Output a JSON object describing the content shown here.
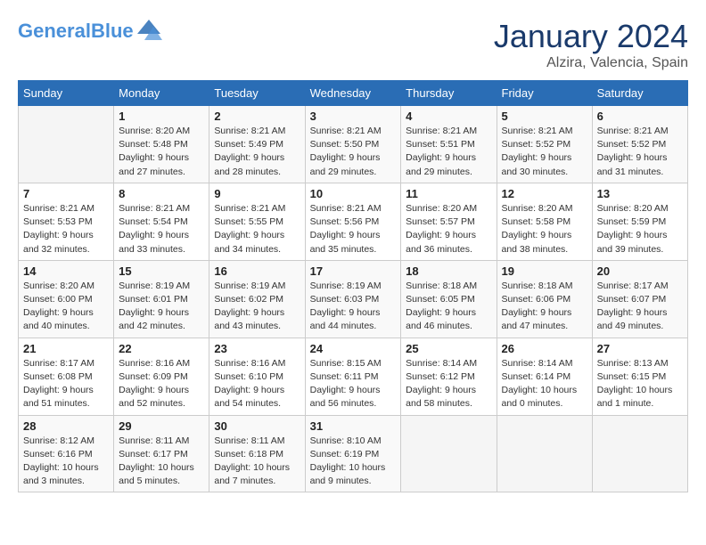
{
  "header": {
    "logo_text_general": "General",
    "logo_text_blue": "Blue",
    "month_title": "January 2024",
    "subtitle": "Alzira, Valencia, Spain"
  },
  "calendar": {
    "days_of_week": [
      "Sunday",
      "Monday",
      "Tuesday",
      "Wednesday",
      "Thursday",
      "Friday",
      "Saturday"
    ],
    "weeks": [
      [
        {
          "day": "",
          "info": ""
        },
        {
          "day": "1",
          "info": "Sunrise: 8:20 AM\nSunset: 5:48 PM\nDaylight: 9 hours\nand 27 minutes."
        },
        {
          "day": "2",
          "info": "Sunrise: 8:21 AM\nSunset: 5:49 PM\nDaylight: 9 hours\nand 28 minutes."
        },
        {
          "day": "3",
          "info": "Sunrise: 8:21 AM\nSunset: 5:50 PM\nDaylight: 9 hours\nand 29 minutes."
        },
        {
          "day": "4",
          "info": "Sunrise: 8:21 AM\nSunset: 5:51 PM\nDaylight: 9 hours\nand 29 minutes."
        },
        {
          "day": "5",
          "info": "Sunrise: 8:21 AM\nSunset: 5:52 PM\nDaylight: 9 hours\nand 30 minutes."
        },
        {
          "day": "6",
          "info": "Sunrise: 8:21 AM\nSunset: 5:52 PM\nDaylight: 9 hours\nand 31 minutes."
        }
      ],
      [
        {
          "day": "7",
          "info": "Sunrise: 8:21 AM\nSunset: 5:53 PM\nDaylight: 9 hours\nand 32 minutes."
        },
        {
          "day": "8",
          "info": "Sunrise: 8:21 AM\nSunset: 5:54 PM\nDaylight: 9 hours\nand 33 minutes."
        },
        {
          "day": "9",
          "info": "Sunrise: 8:21 AM\nSunset: 5:55 PM\nDaylight: 9 hours\nand 34 minutes."
        },
        {
          "day": "10",
          "info": "Sunrise: 8:21 AM\nSunset: 5:56 PM\nDaylight: 9 hours\nand 35 minutes."
        },
        {
          "day": "11",
          "info": "Sunrise: 8:20 AM\nSunset: 5:57 PM\nDaylight: 9 hours\nand 36 minutes."
        },
        {
          "day": "12",
          "info": "Sunrise: 8:20 AM\nSunset: 5:58 PM\nDaylight: 9 hours\nand 38 minutes."
        },
        {
          "day": "13",
          "info": "Sunrise: 8:20 AM\nSunset: 5:59 PM\nDaylight: 9 hours\nand 39 minutes."
        }
      ],
      [
        {
          "day": "14",
          "info": "Sunrise: 8:20 AM\nSunset: 6:00 PM\nDaylight: 9 hours\nand 40 minutes."
        },
        {
          "day": "15",
          "info": "Sunrise: 8:19 AM\nSunset: 6:01 PM\nDaylight: 9 hours\nand 42 minutes."
        },
        {
          "day": "16",
          "info": "Sunrise: 8:19 AM\nSunset: 6:02 PM\nDaylight: 9 hours\nand 43 minutes."
        },
        {
          "day": "17",
          "info": "Sunrise: 8:19 AM\nSunset: 6:03 PM\nDaylight: 9 hours\nand 44 minutes."
        },
        {
          "day": "18",
          "info": "Sunrise: 8:18 AM\nSunset: 6:05 PM\nDaylight: 9 hours\nand 46 minutes."
        },
        {
          "day": "19",
          "info": "Sunrise: 8:18 AM\nSunset: 6:06 PM\nDaylight: 9 hours\nand 47 minutes."
        },
        {
          "day": "20",
          "info": "Sunrise: 8:17 AM\nSunset: 6:07 PM\nDaylight: 9 hours\nand 49 minutes."
        }
      ],
      [
        {
          "day": "21",
          "info": "Sunrise: 8:17 AM\nSunset: 6:08 PM\nDaylight: 9 hours\nand 51 minutes."
        },
        {
          "day": "22",
          "info": "Sunrise: 8:16 AM\nSunset: 6:09 PM\nDaylight: 9 hours\nand 52 minutes."
        },
        {
          "day": "23",
          "info": "Sunrise: 8:16 AM\nSunset: 6:10 PM\nDaylight: 9 hours\nand 54 minutes."
        },
        {
          "day": "24",
          "info": "Sunrise: 8:15 AM\nSunset: 6:11 PM\nDaylight: 9 hours\nand 56 minutes."
        },
        {
          "day": "25",
          "info": "Sunrise: 8:14 AM\nSunset: 6:12 PM\nDaylight: 9 hours\nand 58 minutes."
        },
        {
          "day": "26",
          "info": "Sunrise: 8:14 AM\nSunset: 6:14 PM\nDaylight: 10 hours\nand 0 minutes."
        },
        {
          "day": "27",
          "info": "Sunrise: 8:13 AM\nSunset: 6:15 PM\nDaylight: 10 hours\nand 1 minute."
        }
      ],
      [
        {
          "day": "28",
          "info": "Sunrise: 8:12 AM\nSunset: 6:16 PM\nDaylight: 10 hours\nand 3 minutes."
        },
        {
          "day": "29",
          "info": "Sunrise: 8:11 AM\nSunset: 6:17 PM\nDaylight: 10 hours\nand 5 minutes."
        },
        {
          "day": "30",
          "info": "Sunrise: 8:11 AM\nSunset: 6:18 PM\nDaylight: 10 hours\nand 7 minutes."
        },
        {
          "day": "31",
          "info": "Sunrise: 8:10 AM\nSunset: 6:19 PM\nDaylight: 10 hours\nand 9 minutes."
        },
        {
          "day": "",
          "info": ""
        },
        {
          "day": "",
          "info": ""
        },
        {
          "day": "",
          "info": ""
        }
      ]
    ]
  }
}
